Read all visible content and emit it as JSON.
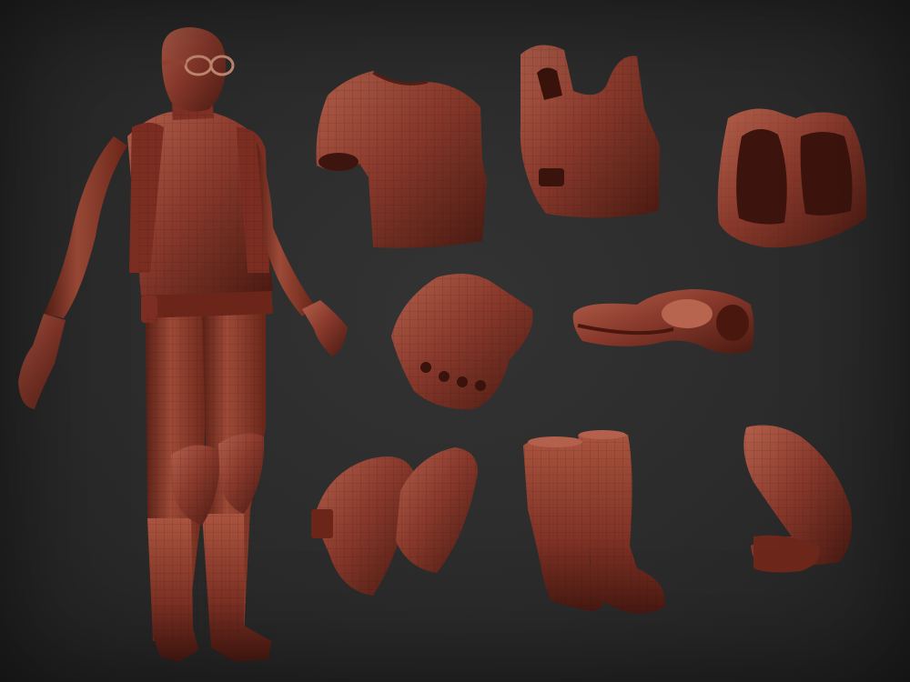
{
  "scene": {
    "background_color": "#2b2b2b",
    "material_color": "#8a3a2c",
    "material_highlight": "#b3604c",
    "material_shadow": "#4a1a12",
    "objects": [
      "full-character-figure",
      "t-shirt-piece",
      "tank-vest-piece",
      "harness-strap-piece",
      "fingerless-glove-piece",
      "goggles-piece",
      "knee-pads-piece",
      "boots-piece",
      "shoulder-pad-piece"
    ]
  }
}
